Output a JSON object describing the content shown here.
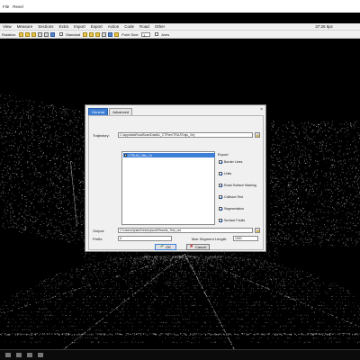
{
  "window": {
    "title_left": "File",
    "title_right": "Revel"
  },
  "menu": {
    "items": [
      "View",
      "Measure",
      "Sections",
      "Extra",
      "Import",
      "Export",
      "Action",
      "Code",
      "Road",
      "Other"
    ],
    "time": "37:26 5pc"
  },
  "toolbar": {
    "rotation_label": "Rotation:",
    "standard_label": "Standard",
    "point_size_label": "Point Size:",
    "point_size_value": "3",
    "axes_label": "Axes"
  },
  "dialog": {
    "tabs": [
      "General",
      "Advanced"
    ],
    "close_label": "×",
    "trajectory_label": "Trajectory:",
    "trajectory_value": "C:\\appdata\\RoadScan\\Data\\U_CTR\\ex\\TRAJ\\Trajs_\\l.trj",
    "list_items": [
      "CTRU11_Site_14"
    ],
    "export": {
      "title": "Export",
      "items": [
        {
          "label": "Border Lines",
          "checked": true
        },
        {
          "label": "Units",
          "checked": true
        },
        {
          "label": "Road Surface Marking",
          "checked": true
        },
        {
          "label": "Collision Test",
          "checked": true
        },
        {
          "label": "Segmentation",
          "checked": true
        },
        {
          "label": "Surface Faults",
          "checked": true
        }
      ]
    },
    "output_label": "Output:",
    "output_value": "C:\\Users\\dylan\\Desktop\\out\\Results_Test_out",
    "prefix_label": "Prefix:",
    "prefix_value": "rf",
    "max_segment_label": "Max Segment Length:",
    "max_segment_value": "1000",
    "ok_label": "OK",
    "cancel_label": "Cancel"
  },
  "colors": {
    "accent": "#3d7fd6",
    "viewport_bg": "#000000",
    "point_cloud": "#cfcfcf"
  }
}
